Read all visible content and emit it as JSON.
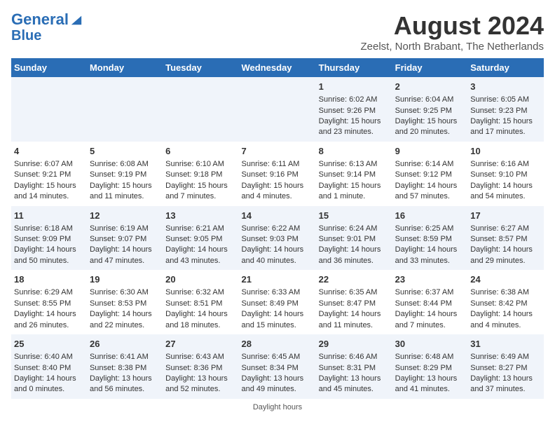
{
  "header": {
    "logo_line1": "General",
    "logo_line2": "Blue",
    "main_title": "August 2024",
    "subtitle": "Zeelst, North Brabant, The Netherlands"
  },
  "days_of_week": [
    "Sunday",
    "Monday",
    "Tuesday",
    "Wednesday",
    "Thursday",
    "Friday",
    "Saturday"
  ],
  "weeks": [
    [
      {
        "day": "",
        "info": ""
      },
      {
        "day": "",
        "info": ""
      },
      {
        "day": "",
        "info": ""
      },
      {
        "day": "",
        "info": ""
      },
      {
        "day": "1",
        "info": "Sunrise: 6:02 AM\nSunset: 9:26 PM\nDaylight: 15 hours\nand 23 minutes."
      },
      {
        "day": "2",
        "info": "Sunrise: 6:04 AM\nSunset: 9:25 PM\nDaylight: 15 hours\nand 20 minutes."
      },
      {
        "day": "3",
        "info": "Sunrise: 6:05 AM\nSunset: 9:23 PM\nDaylight: 15 hours\nand 17 minutes."
      }
    ],
    [
      {
        "day": "4",
        "info": "Sunrise: 6:07 AM\nSunset: 9:21 PM\nDaylight: 15 hours\nand 14 minutes."
      },
      {
        "day": "5",
        "info": "Sunrise: 6:08 AM\nSunset: 9:19 PM\nDaylight: 15 hours\nand 11 minutes."
      },
      {
        "day": "6",
        "info": "Sunrise: 6:10 AM\nSunset: 9:18 PM\nDaylight: 15 hours\nand 7 minutes."
      },
      {
        "day": "7",
        "info": "Sunrise: 6:11 AM\nSunset: 9:16 PM\nDaylight: 15 hours\nand 4 minutes."
      },
      {
        "day": "8",
        "info": "Sunrise: 6:13 AM\nSunset: 9:14 PM\nDaylight: 15 hours\nand 1 minute."
      },
      {
        "day": "9",
        "info": "Sunrise: 6:14 AM\nSunset: 9:12 PM\nDaylight: 14 hours\nand 57 minutes."
      },
      {
        "day": "10",
        "info": "Sunrise: 6:16 AM\nSunset: 9:10 PM\nDaylight: 14 hours\nand 54 minutes."
      }
    ],
    [
      {
        "day": "11",
        "info": "Sunrise: 6:18 AM\nSunset: 9:09 PM\nDaylight: 14 hours\nand 50 minutes."
      },
      {
        "day": "12",
        "info": "Sunrise: 6:19 AM\nSunset: 9:07 PM\nDaylight: 14 hours\nand 47 minutes."
      },
      {
        "day": "13",
        "info": "Sunrise: 6:21 AM\nSunset: 9:05 PM\nDaylight: 14 hours\nand 43 minutes."
      },
      {
        "day": "14",
        "info": "Sunrise: 6:22 AM\nSunset: 9:03 PM\nDaylight: 14 hours\nand 40 minutes."
      },
      {
        "day": "15",
        "info": "Sunrise: 6:24 AM\nSunset: 9:01 PM\nDaylight: 14 hours\nand 36 minutes."
      },
      {
        "day": "16",
        "info": "Sunrise: 6:25 AM\nSunset: 8:59 PM\nDaylight: 14 hours\nand 33 minutes."
      },
      {
        "day": "17",
        "info": "Sunrise: 6:27 AM\nSunset: 8:57 PM\nDaylight: 14 hours\nand 29 minutes."
      }
    ],
    [
      {
        "day": "18",
        "info": "Sunrise: 6:29 AM\nSunset: 8:55 PM\nDaylight: 14 hours\nand 26 minutes."
      },
      {
        "day": "19",
        "info": "Sunrise: 6:30 AM\nSunset: 8:53 PM\nDaylight: 14 hours\nand 22 minutes."
      },
      {
        "day": "20",
        "info": "Sunrise: 6:32 AM\nSunset: 8:51 PM\nDaylight: 14 hours\nand 18 minutes."
      },
      {
        "day": "21",
        "info": "Sunrise: 6:33 AM\nSunset: 8:49 PM\nDaylight: 14 hours\nand 15 minutes."
      },
      {
        "day": "22",
        "info": "Sunrise: 6:35 AM\nSunset: 8:47 PM\nDaylight: 14 hours\nand 11 minutes."
      },
      {
        "day": "23",
        "info": "Sunrise: 6:37 AM\nSunset: 8:44 PM\nDaylight: 14 hours\nand 7 minutes."
      },
      {
        "day": "24",
        "info": "Sunrise: 6:38 AM\nSunset: 8:42 PM\nDaylight: 14 hours\nand 4 minutes."
      }
    ],
    [
      {
        "day": "25",
        "info": "Sunrise: 6:40 AM\nSunset: 8:40 PM\nDaylight: 14 hours\nand 0 minutes."
      },
      {
        "day": "26",
        "info": "Sunrise: 6:41 AM\nSunset: 8:38 PM\nDaylight: 13 hours\nand 56 minutes."
      },
      {
        "day": "27",
        "info": "Sunrise: 6:43 AM\nSunset: 8:36 PM\nDaylight: 13 hours\nand 52 minutes."
      },
      {
        "day": "28",
        "info": "Sunrise: 6:45 AM\nSunset: 8:34 PM\nDaylight: 13 hours\nand 49 minutes."
      },
      {
        "day": "29",
        "info": "Sunrise: 6:46 AM\nSunset: 8:31 PM\nDaylight: 13 hours\nand 45 minutes."
      },
      {
        "day": "30",
        "info": "Sunrise: 6:48 AM\nSunset: 8:29 PM\nDaylight: 13 hours\nand 41 minutes."
      },
      {
        "day": "31",
        "info": "Sunrise: 6:49 AM\nSunset: 8:27 PM\nDaylight: 13 hours\nand 37 minutes."
      }
    ]
  ],
  "footer": {
    "label": "Daylight hours"
  }
}
